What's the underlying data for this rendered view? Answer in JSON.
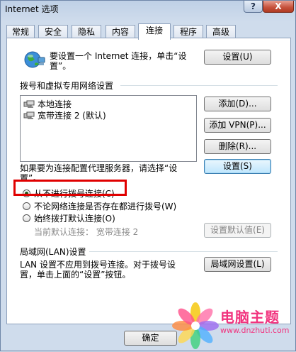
{
  "window": {
    "title": "Internet 选项",
    "help_label": "?",
    "close_label": "X"
  },
  "tabs": [
    {
      "label": "常规"
    },
    {
      "label": "安全"
    },
    {
      "label": "隐私"
    },
    {
      "label": "内容"
    },
    {
      "label": "连接"
    },
    {
      "label": "程序"
    },
    {
      "label": "高级"
    }
  ],
  "active_tab": "连接",
  "setup": {
    "text": "要设置一个 Internet 连接，单击“设置”。",
    "button": "设置(U)"
  },
  "dialup": {
    "group_label": "拨号和虚拟专用网络设置",
    "connections": [
      {
        "name": "本地连接"
      },
      {
        "name": "宽带连接 2 (默认)"
      }
    ],
    "add_button": "添加(D)...",
    "add_vpn_button": "添加 VPN(P)...",
    "remove_button": "删除(R)...",
    "proxy_text": "如果要为连接配置代理服务器，请选择“设置”。",
    "settings_button": "设置(S)",
    "options": [
      {
        "label": "从不进行拨号连接(C)",
        "checked": true
      },
      {
        "label": "不论网络连接是否存在都进行拨号(W)",
        "checked": false
      },
      {
        "label": "始终拨打默认连接(O)",
        "checked": false
      }
    ],
    "current_default_label": "当前默认连接：",
    "current_default_value": "宽带连接 2",
    "set_default_button": "设置默认值(E)"
  },
  "lan": {
    "group_label": "局域网(LAN)设置",
    "text_line1": "LAN 设置不应用到拨号连接。对于拨号设",
    "text_line2": "置，单击上面的“设置”按钮。",
    "button": "局域网设置(L)"
  },
  "footer": {
    "ok_button": "确定"
  },
  "watermark": {
    "brand": "电脑主题",
    "url": "www.dnzhuti.com"
  },
  "colors": {
    "highlight": "#e00000",
    "watermark": "#f1337e"
  }
}
